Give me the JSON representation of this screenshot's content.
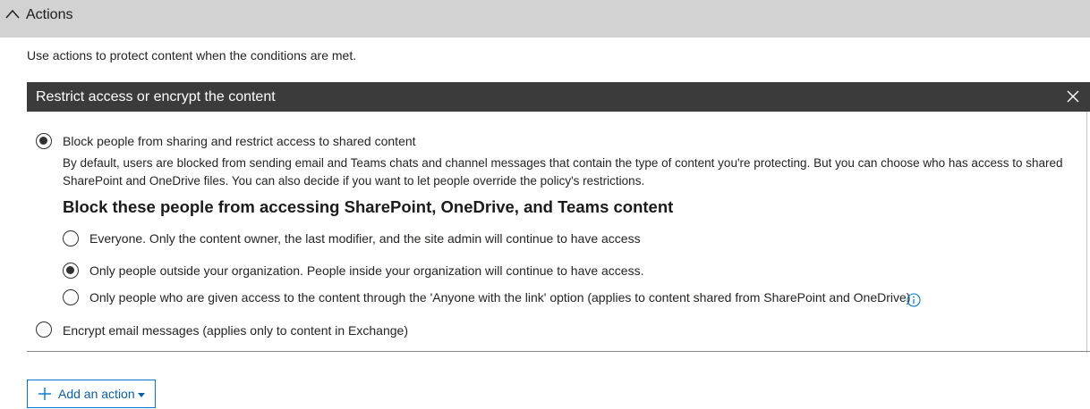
{
  "section": {
    "title": "Actions"
  },
  "intro_text": "Use actions to protect content when the conditions are met.",
  "card": {
    "title": "Restrict access or encrypt the content",
    "option_block": {
      "label": "Block people from sharing and restrict access to shared content",
      "checked": true,
      "description": "By default, users are blocked from sending email and Teams chats and channel messages that contain the type of content you're protecting. But you can choose who has access to shared SharePoint and OneDrive files. You can also decide if you want to let people override the policy's restrictions."
    },
    "subheading": "Block these people from accessing SharePoint, OneDrive, and Teams content",
    "sub_options": [
      {
        "label": "Everyone. Only the content owner, the last modifier, and the site admin will continue to have access",
        "checked": false
      },
      {
        "label": "Only people outside your organization. People inside your organization will continue to have access.",
        "checked": true
      },
      {
        "label": "Only people who are given access to the content through the 'Anyone with the link' option (applies to content shared from SharePoint and OneDrive)",
        "checked": false,
        "icon": "info-icon"
      }
    ],
    "option_encrypt": {
      "label": "Encrypt email messages (applies only to content in Exchange)",
      "checked": false
    }
  },
  "add_action": {
    "label": "Add an action",
    "icon": "plus-icon"
  },
  "colors": {
    "header_bg": "#d2d2d2",
    "card_header_bg": "#3b3b3b",
    "accent": "#0078d4"
  }
}
